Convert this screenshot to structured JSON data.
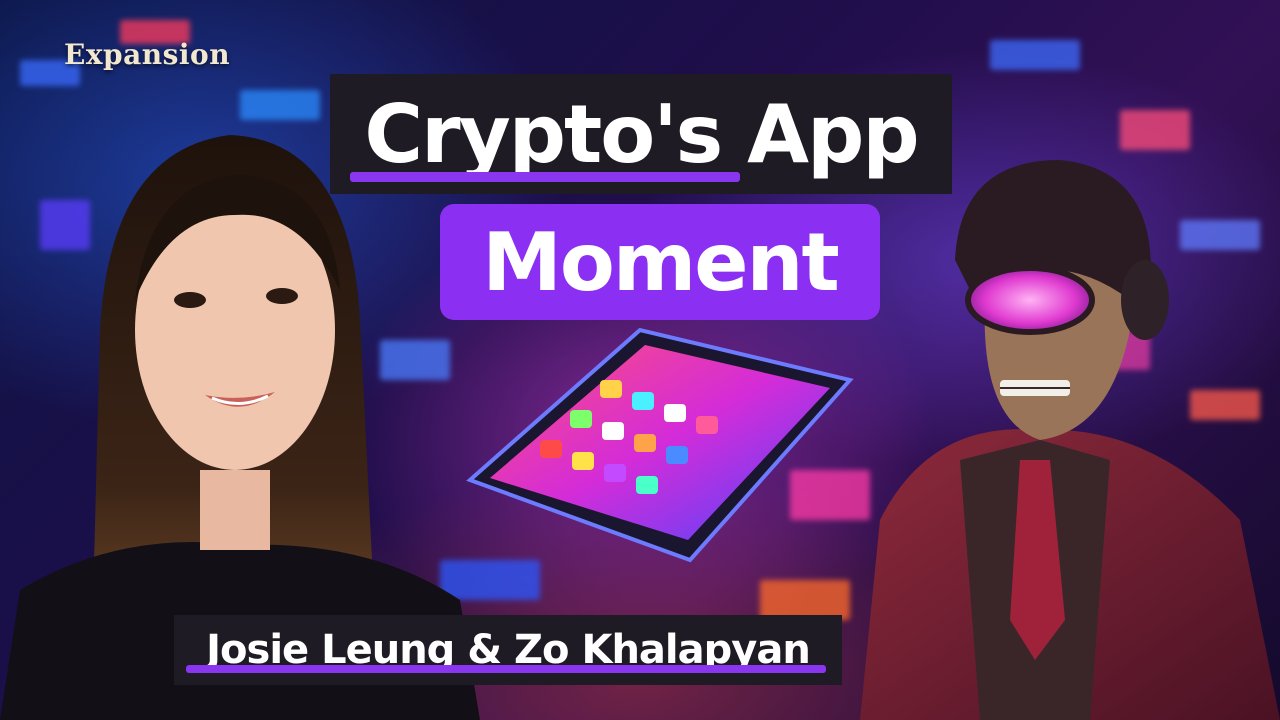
{
  "thumbnail": {
    "brand": "Expansion",
    "title_line1": "Crypto's App",
    "title_line2": "Moment",
    "names": "Josie Leung & Zo Khalapyan"
  },
  "colors": {
    "accent": "#8b2ff2",
    "label_background": "#1e1b24",
    "brand_text": "#f2e8cf"
  },
  "icons": [
    "smartphone-icon",
    "app-icons"
  ]
}
